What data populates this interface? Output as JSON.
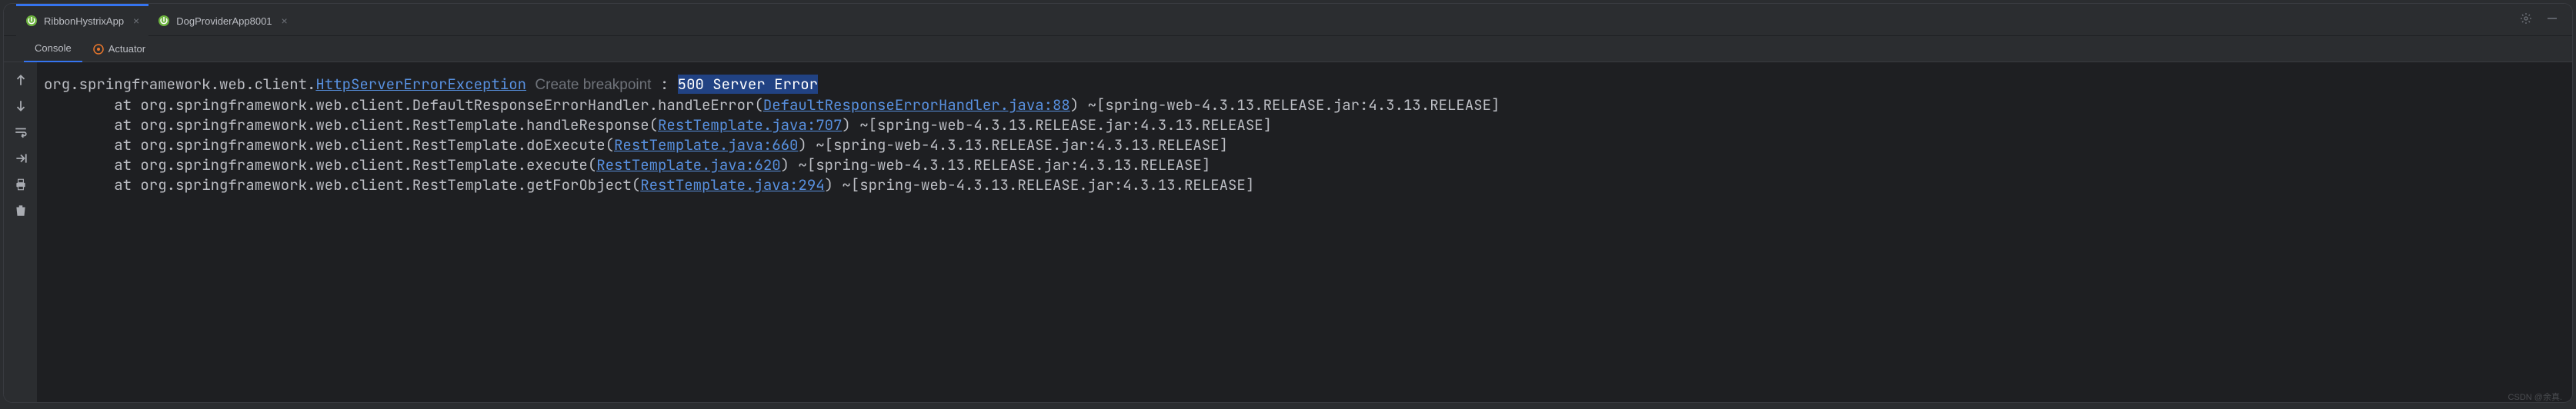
{
  "tabs": [
    {
      "label": "RibbonHystrixApp",
      "active": true
    },
    {
      "label": "DogProviderApp8001",
      "active": false
    }
  ],
  "subTabs": {
    "console": "Console",
    "actuator": "Actuator"
  },
  "console": {
    "line0": {
      "prefix": "org.springframework.web.client.",
      "exception": "HttpServerErrorException",
      "hint": "Create breakpoint",
      "colon": " : ",
      "selected": "500 Server Error"
    },
    "stack": [
      {
        "indent": "\tat org.springframework.web.client.DefaultResponseErrorHandler.handleError(",
        "link": "DefaultResponseErrorHandler.java:88",
        "suffix": ") ~[spring-web-4.3.13.RELEASE.jar:4.3.13.RELEASE]"
      },
      {
        "indent": "\tat org.springframework.web.client.RestTemplate.handleResponse(",
        "link": "RestTemplate.java:707",
        "suffix": ") ~[spring-web-4.3.13.RELEASE.jar:4.3.13.RELEASE]"
      },
      {
        "indent": "\tat org.springframework.web.client.RestTemplate.doExecute(",
        "link": "RestTemplate.java:660",
        "suffix": ") ~[spring-web-4.3.13.RELEASE.jar:4.3.13.RELEASE]"
      },
      {
        "indent": "\tat org.springframework.web.client.RestTemplate.execute(",
        "link": "RestTemplate.java:620",
        "suffix": ") ~[spring-web-4.3.13.RELEASE.jar:4.3.13.RELEASE]"
      },
      {
        "indent": "\tat org.springframework.web.client.RestTemplate.getForObject(",
        "link": "RestTemplate.java:294",
        "suffix": ") ~[spring-web-4.3.13.RELEASE.jar:4.3.13.RELEASE]"
      }
    ]
  },
  "watermark": "CSDN @余真."
}
